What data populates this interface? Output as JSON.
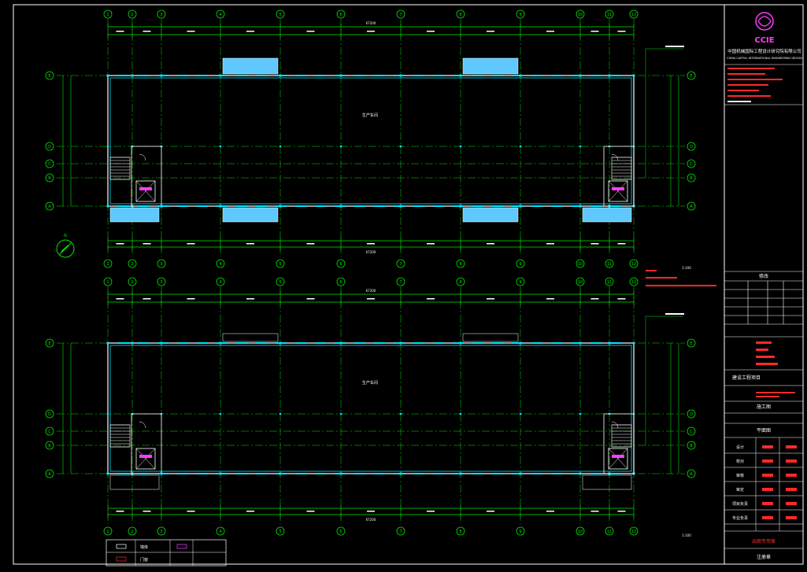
{
  "drawing": {
    "company_name": "中国机械国际工程设计研究院有限公司",
    "company_logo_text": "CCIE",
    "company_subtitle": "CHINA CAPITAL INTERNATIONAL ENGINEERING DESIGN",
    "north_label": "N"
  },
  "grid": {
    "column_labels": [
      "1",
      "2",
      "3",
      "4",
      "5",
      "6",
      "7",
      "8",
      "9",
      "10",
      "11",
      "12"
    ],
    "row_labels": [
      "E",
      "D",
      "C",
      "B",
      "A"
    ]
  },
  "plans": {
    "upper": {
      "room_label": "生产车间",
      "overall_dim": "67200",
      "scale_label": "1:100"
    },
    "lower": {
      "room_label": "生产车间",
      "overall_dim": "67200",
      "scale_label": "1:100"
    }
  },
  "title_block": {
    "project_title": "建设工程项目",
    "drawing_stage": "施工图",
    "drawing_title": "平面图",
    "rows": [
      "设计",
      "校对",
      "审核",
      "审定",
      "项目负责",
      "专业负责"
    ],
    "revision_header": "修改",
    "footer_lines": [
      "出图专用章",
      "注册章"
    ]
  },
  "legend": {
    "items": [
      "墙体",
      "门窗"
    ]
  },
  "colors": {
    "background": "#000000",
    "grid": "#00e400",
    "walls": "#ffffff",
    "cyan": "#00e5ff",
    "blue_fill": "#5ec8ff",
    "magenta": "#ff3cff",
    "red": "#ff2a2a",
    "frame": "#ffffff"
  }
}
